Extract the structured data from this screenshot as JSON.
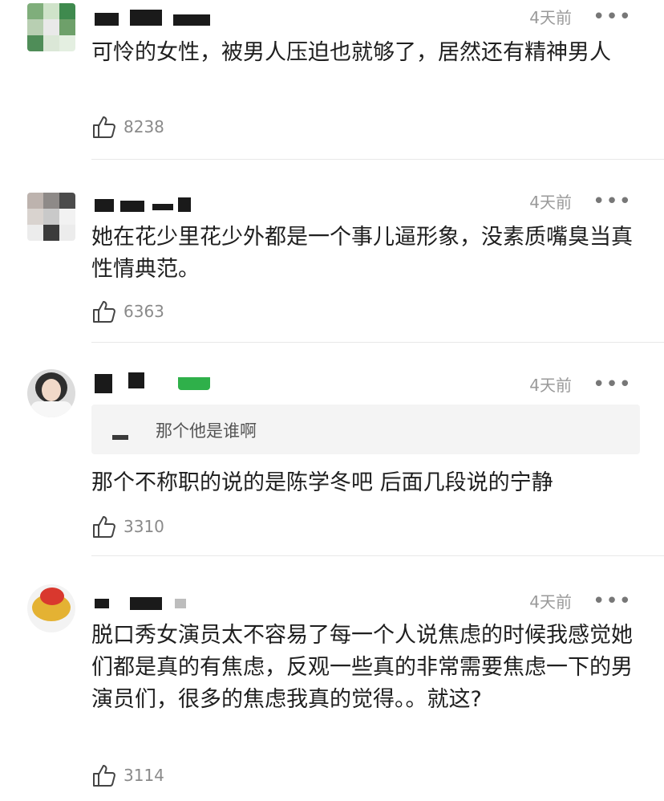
{
  "comments": [
    {
      "time": "4天前",
      "text": "可怜的女性，被男人压迫也就够了，居然还有精神男人",
      "likes": "8238"
    },
    {
      "time": "4天前",
      "text": "她在花少里花少外都是一个事儿逼形象，没素质嘴臭当真性情典范。",
      "likes": "6363"
    },
    {
      "time": "4天前",
      "reply_quote": "那个他是谁啊",
      "text": "那个不称职的说的是陈学冬吧 后面几段说的宁静",
      "likes": "3310"
    },
    {
      "time": "4天前",
      "text": "脱口秀女演员太不容易了每一个人说焦虑的时候我感觉她们都是真的有焦虑，反观一些真的非常需要焦虑一下的男演员们，很多的焦虑我真的觉得。。就这?",
      "likes": "3114"
    }
  ],
  "icons": {
    "more": "more-icon",
    "like": "thumbs-up-icon"
  },
  "colors": {
    "time": "#9a9a9a",
    "like": "#8a8a8a",
    "divider": "#e8e8e8"
  }
}
